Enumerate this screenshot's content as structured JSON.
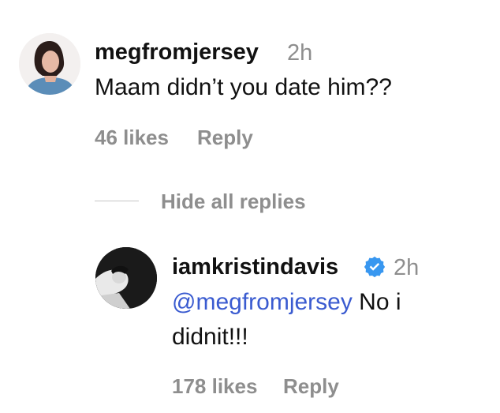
{
  "comment": {
    "username": "megfromjersey",
    "time": "2h",
    "text": "Maam didn’t you date him??",
    "likes": "46 likes",
    "reply": "Reply"
  },
  "replies_toggle": {
    "label": "Hide all replies"
  },
  "reply_comment": {
    "username": "iamkristindavis",
    "verified": true,
    "time": "2h",
    "mention": "@megfromjersey",
    "text_after_mention": " No i",
    "text_line2": "didnit!!!",
    "likes": "178 likes",
    "reply": "Reply"
  },
  "colors": {
    "mention": "#3a5bd0",
    "verified_badge": "#3897f0",
    "muted": "#8e8e8e"
  }
}
